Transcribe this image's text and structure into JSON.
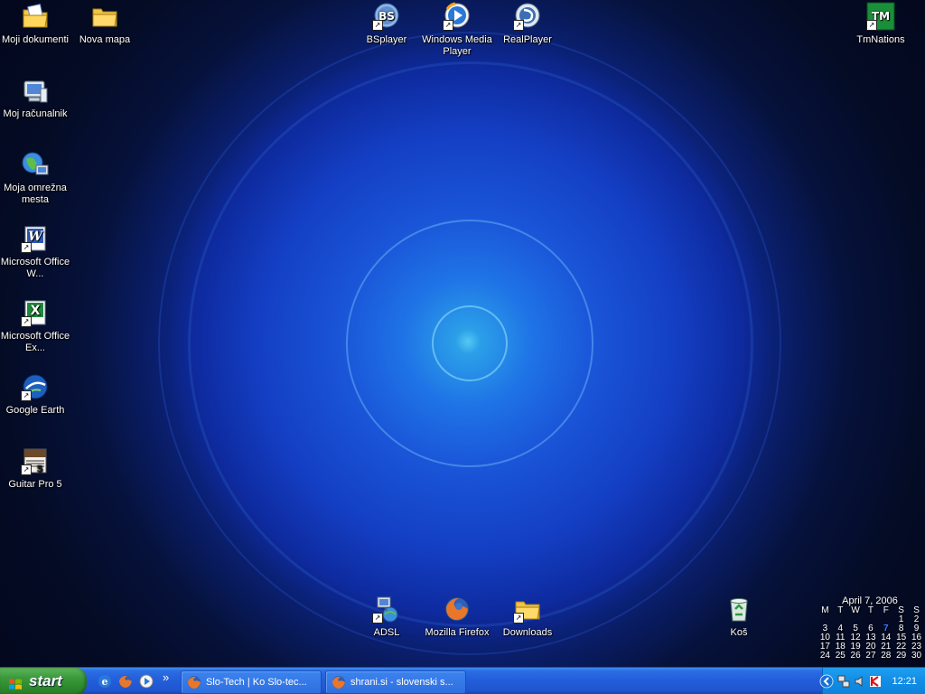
{
  "desktop": {
    "icons": [
      {
        "label": "Moji dokumenti",
        "icon": "my-documents-icon"
      },
      {
        "label": "Nova mapa",
        "icon": "folder-icon"
      },
      {
        "label": "Moj računalnik",
        "icon": "my-computer-icon"
      },
      {
        "label": "Moja omrežna mesta",
        "icon": "network-places-icon"
      },
      {
        "label": "Microsoft Office W...",
        "icon": "word-icon"
      },
      {
        "label": "Microsoft Office Ex...",
        "icon": "excel-icon"
      },
      {
        "label": "Google Earth",
        "icon": "google-earth-icon"
      },
      {
        "label": "Guitar Pro 5",
        "icon": "guitar-pro-icon"
      },
      {
        "label": "BSplayer",
        "icon": "bsplayer-icon"
      },
      {
        "label": "Windows Media Player",
        "icon": "windows-media-player-icon"
      },
      {
        "label": "RealPlayer",
        "icon": "realplayer-icon"
      },
      {
        "label": "TmNations",
        "icon": "tmnations-icon"
      },
      {
        "label": "ADSL",
        "icon": "network-connection-icon"
      },
      {
        "label": "Mozilla Firefox",
        "icon": "firefox-icon"
      },
      {
        "label": "Downloads",
        "icon": "folder-icon"
      },
      {
        "label": "Koš",
        "icon": "recycle-bin-icon"
      }
    ]
  },
  "calendar": {
    "title": "April 7, 2006",
    "weekdays": [
      "M",
      "T",
      "W",
      "T",
      "F",
      "S",
      "S"
    ],
    "weeks": [
      [
        "",
        "",
        "",
        "",
        "",
        "1",
        "2"
      ],
      [
        "3",
        "4",
        "5",
        "6",
        "7",
        "8",
        "9"
      ],
      [
        "10",
        "11",
        "12",
        "13",
        "14",
        "15",
        "16"
      ],
      [
        "17",
        "18",
        "19",
        "20",
        "21",
        "22",
        "23"
      ],
      [
        "24",
        "25",
        "26",
        "27",
        "28",
        "29",
        "30"
      ]
    ],
    "today": "7"
  },
  "taskbar": {
    "start_label": "start",
    "quick_launch_overflow": "»",
    "tasks": [
      {
        "label": "Slo-Tech | Ko Slo-tec...",
        "icon": "firefox-icon"
      },
      {
        "label": "shrani.si - slovenski s...",
        "icon": "firefox-icon"
      }
    ],
    "clock": "12:21"
  },
  "colors": {
    "taskbar": "#245edb",
    "start_button": "#3c9a3c",
    "tray": "#1290e8",
    "wallpaper_center": "#55c8f2",
    "wallpaper_edge": "#02061a"
  }
}
